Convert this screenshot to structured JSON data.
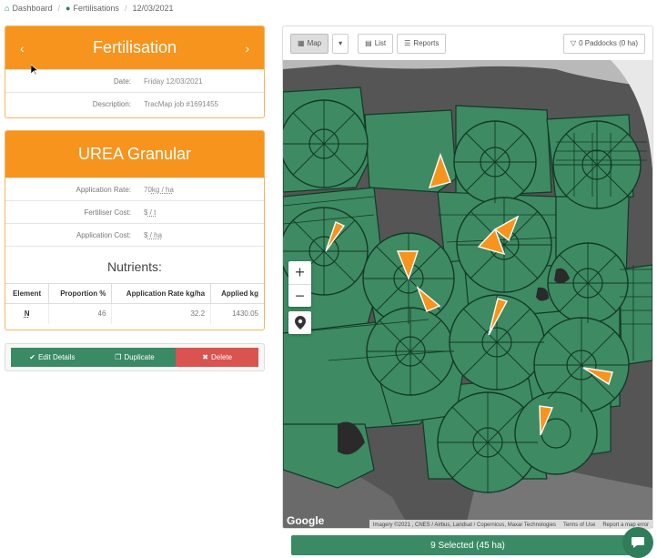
{
  "breadcrumb": {
    "home": "Dashboard",
    "section": "Fertilisations",
    "current": "12/03/2021"
  },
  "fertilisation": {
    "title": "Fertilisation",
    "prev_icon": "chevron-left-icon",
    "next_icon": "chevron-right-icon",
    "date_label": "Date:",
    "date_value": "Friday 12/03/2021",
    "description_label": "Description:",
    "description_value": "TracMap job #1691455"
  },
  "product": {
    "title": "UREA Granular",
    "rate_label": "Application Rate:",
    "rate_value": "70",
    "rate_unit": "kg / ha",
    "cost_label": "Fertiliser Cost:",
    "cost_value": "$",
    "cost_unit": " / t",
    "appcost_label": "Application Cost:",
    "appcost_value": "$",
    "appcost_unit": " / ha"
  },
  "nutrients": {
    "title": "Nutrients:",
    "columns": [
      "Element",
      "Proportion %",
      "Application Rate kg/ha",
      "Applied kg"
    ],
    "rows": [
      {
        "element": "N",
        "proportion": "46",
        "rate": "32.2",
        "applied": "1430.05"
      }
    ]
  },
  "actions": {
    "edit": "Edit Details",
    "duplicate": "Duplicate",
    "delete": "Delete"
  },
  "map": {
    "view_label": "Map",
    "list_label": "List",
    "reports_label": "Reports",
    "paddocks_filter": "0 Paddocks (0 ha)",
    "google": "Google",
    "attribution": "Imagery ©2021 , CNES / Airbus, Landsat / Copernicus, Maxar Technologies",
    "terms": "Terms of Use",
    "report": "Report a map error",
    "paddock_color": "#3e8a63",
    "selected_color": "#f7941d"
  },
  "selection": {
    "label": "9 Selected (45 ha)"
  },
  "colors": {
    "accent_orange": "#f7941d",
    "brand_green": "#3a8a66",
    "danger_red": "#d9534f"
  }
}
